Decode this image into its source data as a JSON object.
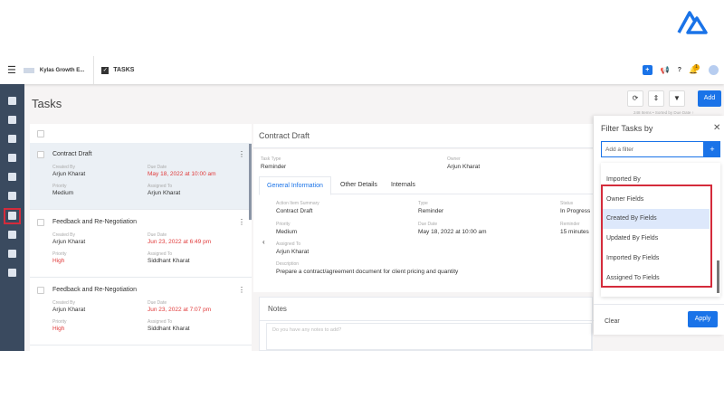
{
  "topbar": {
    "company": "Kylas Growth E...",
    "module": "TASKS",
    "notification_count": "1"
  },
  "page": {
    "title": "Tasks",
    "add_label": "Add",
    "list_meta": "248 Items • Sorted by Due Date ↑"
  },
  "tasks": [
    {
      "title": "Contract Draft",
      "created_by_label": "Created By",
      "created_by": "Arjun Kharat",
      "due_label": "Due Date",
      "due": "May 18, 2022 at 10:00 am",
      "priority_label": "Priority",
      "priority": "Medium",
      "assigned_label": "Assigned To",
      "assigned": "Arjun Kharat"
    },
    {
      "title": "Feedback and Re-Negotiation",
      "created_by_label": "Created By",
      "created_by": "Arjun Kharat",
      "due_label": "Due Date",
      "due": "Jun 23, 2022 at 6:49 pm",
      "priority_label": "Priority",
      "priority": "High",
      "assigned_label": "Assigned To",
      "assigned": "Siddhant Kharat"
    },
    {
      "title": "Feedback and Re-Negotiation",
      "created_by_label": "Created By",
      "created_by": "Arjun Kharat",
      "due_label": "Due Date",
      "due": "Jun 23, 2022 at 7:07 pm",
      "priority_label": "Priority",
      "priority": "High",
      "assigned_label": "Assigned To",
      "assigned": "Siddhant Kharat"
    }
  ],
  "detail": {
    "title": "Contract Draft",
    "task_type_label": "Task Type",
    "task_type": "Reminder",
    "owner_label": "Owner",
    "owner": "Arjun Kharat",
    "tabs": [
      "General Information",
      "Other Details",
      "Internals"
    ],
    "fields": {
      "summary_label": "Action Item Summary",
      "summary": "Contract Draft",
      "type_label": "Type",
      "type": "Reminder",
      "status_label": "Status",
      "status": "In Progress",
      "priority_label": "Priority",
      "priority": "Medium",
      "due_label": "Due Date",
      "due": "May 18, 2022 at 10:00 am",
      "reminder_label": "Reminder",
      "reminder": "15 minutes",
      "assigned_label": "Assigned To",
      "assigned": "Arjun Kharat",
      "description_label": "Description",
      "description": "Prepare a contract/agreement document for client pricing and quantity"
    },
    "notes_title": "Notes",
    "notes_placeholder": "Do you have any notes to add?"
  },
  "filter": {
    "title": "Filter Tasks by",
    "placeholder": "Add a filter",
    "options": [
      "Imported By",
      "Owner Fields",
      "Created By Fields",
      "Updated By Fields",
      "Imported By Fields",
      "Assigned To Fields"
    ],
    "clear": "Clear",
    "apply": "Apply"
  },
  "colors": {
    "primary": "#1a73e8",
    "sidebar": "#3a4a5f",
    "danger": "#e03a3a"
  }
}
